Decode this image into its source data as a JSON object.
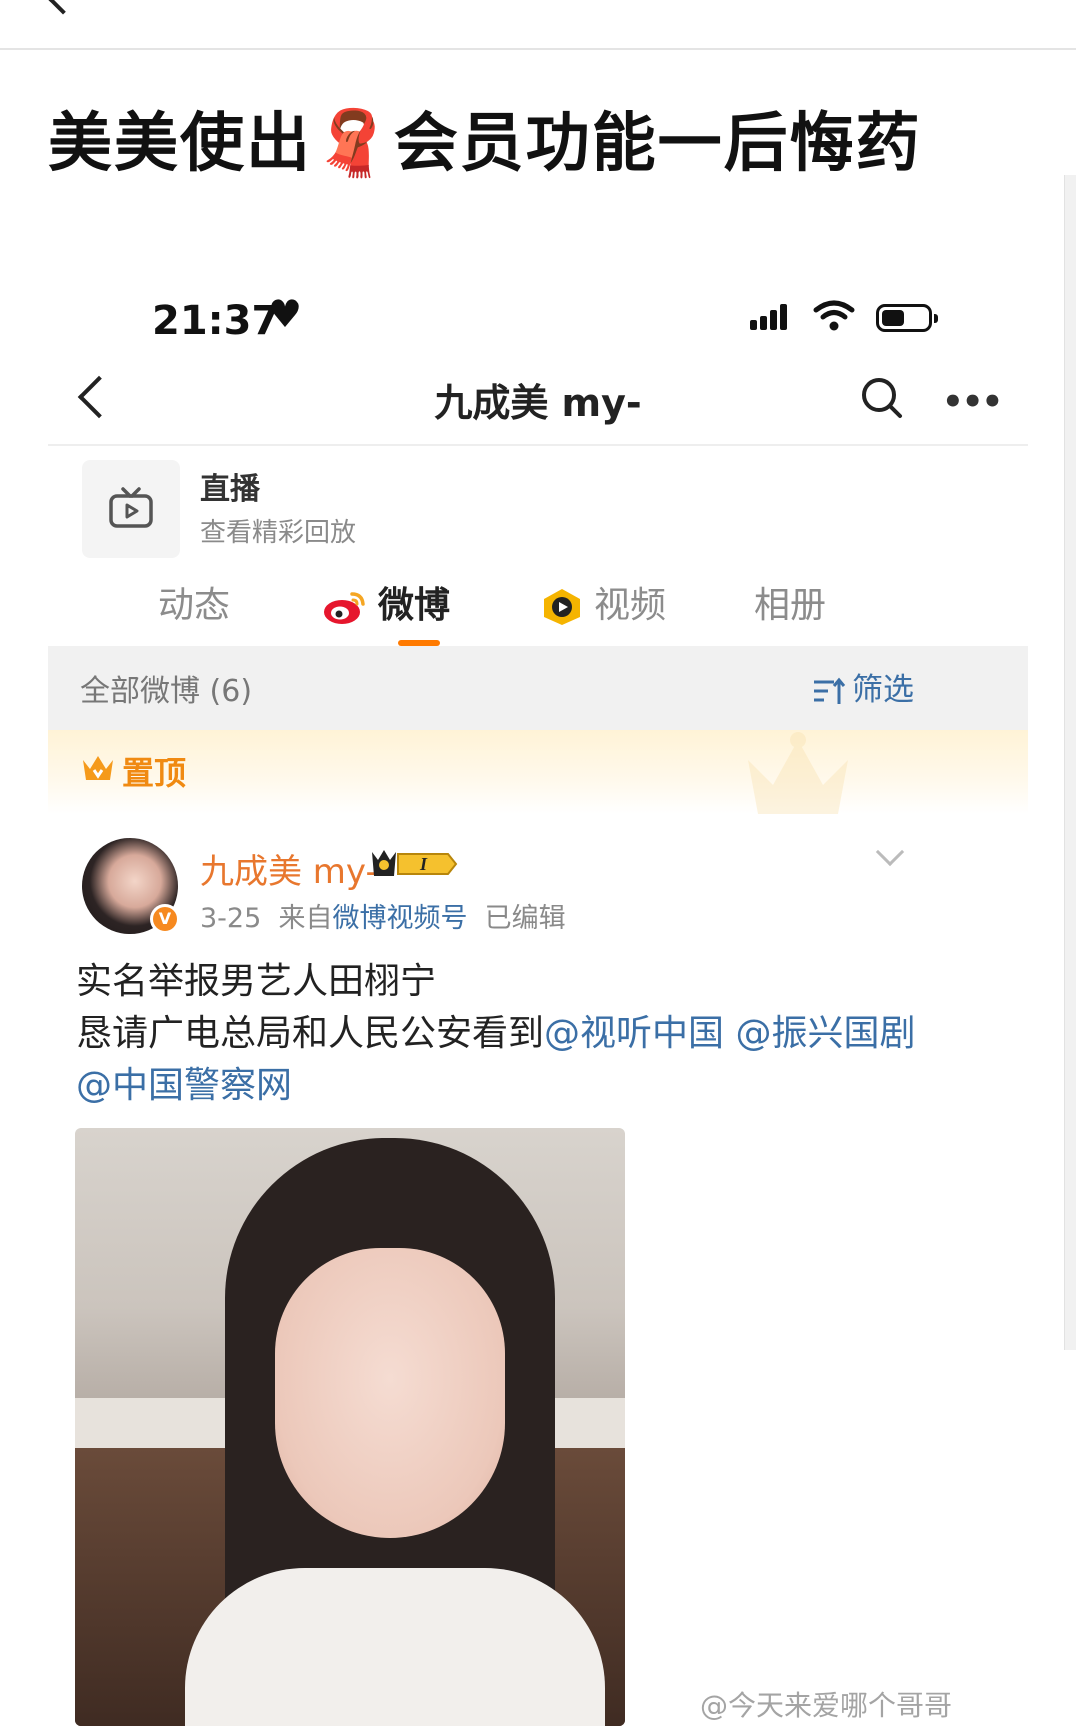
{
  "headline": {
    "part1": "美美使出",
    "scarf_emoji": "🧣",
    "part2": "会员功能一后悔药"
  },
  "status_bar": {
    "time": "21:37",
    "heart": "♥"
  },
  "nav": {
    "title": "九成美 my-",
    "more": "•••"
  },
  "live": {
    "title": "直播",
    "subtitle": "查看精彩回放"
  },
  "tabs": [
    {
      "label": "动态"
    },
    {
      "label": "微博"
    },
    {
      "label": "视频"
    },
    {
      "label": "相册"
    }
  ],
  "filter_bar": {
    "count_label": "全部微博 (6)",
    "filter_label": "筛选"
  },
  "pinned": {
    "label": "置顶"
  },
  "post": {
    "author": "九成美 my-",
    "avatar_badge": "V",
    "vip_level": "I",
    "date": "3-25",
    "from_prefix": "来自",
    "source": "微博视频号",
    "edited": "已编辑",
    "line1": "实名举报男艺人田栩宁",
    "line2": "恳请广电总局和人民公安看到",
    "mention1": "@视听中国",
    "mention2": "@振兴国剧",
    "mention3": "@中国警察网"
  },
  "watermark": "@今天来爱哪个哥哥",
  "colors": {
    "accent_orange": "#ff7a00",
    "link_blue": "#3b6fa6",
    "author_orange": "#e8772e"
  }
}
